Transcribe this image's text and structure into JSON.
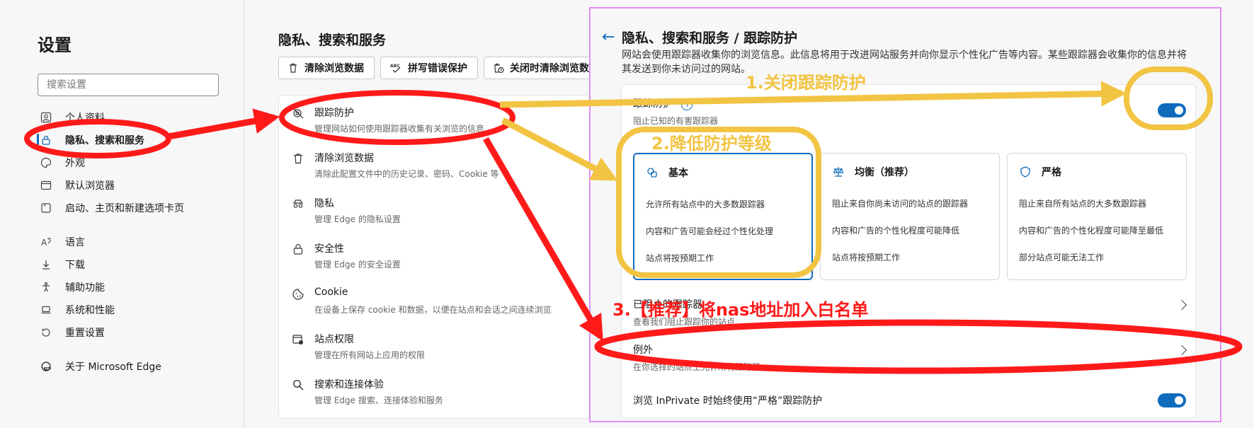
{
  "sidebar": {
    "title": "设置",
    "search_placeholder": "搜索设置",
    "items": [
      {
        "label": "个人资料"
      },
      {
        "label": "隐私、搜索和服务"
      },
      {
        "label": "外观"
      },
      {
        "label": "默认浏览器"
      },
      {
        "label": "启动、主页和新建选项卡页"
      },
      {
        "label": "语言"
      },
      {
        "label": "下载"
      },
      {
        "label": "辅助功能"
      },
      {
        "label": "系统和性能"
      },
      {
        "label": "重置设置"
      },
      {
        "label": "关于 Microsoft Edge"
      }
    ]
  },
  "middle": {
    "title": "隐私、搜索和服务",
    "chips": [
      "清除浏览数据",
      "拼写错误保护",
      "关闭时清除浏览数据"
    ],
    "rows": [
      {
        "title": "跟踪防护",
        "sub": "管理网站如何使用跟踪器收集有关浏览的信息"
      },
      {
        "title": "清除浏览数据",
        "sub": "清除此配置文件中的历史记录、密码、Cookie 等"
      },
      {
        "title": "隐私",
        "sub": "管理 Edge 的隐私设置"
      },
      {
        "title": "安全性",
        "sub": "管理 Edge 的安全设置"
      },
      {
        "title": "Cookie",
        "sub": "在设备上保存 cookie 和数据，以便在站点和会话之间连续浏览"
      },
      {
        "title": "站点权限",
        "sub": "管理在所有网站上应用的权限"
      },
      {
        "title": "搜索和连接体验",
        "sub": "管理 Edge 搜索、连接体验和服务"
      }
    ]
  },
  "panel": {
    "title": "隐私、搜索和服务 / 跟踪防护",
    "desc": "网站会使用跟踪器收集你的浏览信息。此信息将用于改进网站服务并向你显示个性化广告等内容。某些跟踪器会收集你的信息并将其发送到你未访问过的网站。",
    "tp_label": "跟踪防护",
    "tp_sub": "阻止已知的有害跟踪器",
    "levels": [
      {
        "name": "基本",
        "items": [
          "允许所有站点中的大多数跟踪器",
          "内容和广告可能会经过个性化处理",
          "站点将按预期工作"
        ]
      },
      {
        "name": "均衡（推荐）",
        "items": [
          "阻止来自你尚未访问的站点的跟踪器",
          "内容和广告的个性化程度可能降低",
          "站点将按预期工作"
        ]
      },
      {
        "name": "严格",
        "items": [
          "阻止来自所有站点的大多数跟踪器",
          "内容和广告的个性化程度可能降至最低",
          "部分站点可能无法工作"
        ]
      }
    ],
    "blocked_title": "已阻止的跟踪器",
    "blocked_sub": "查看我们阻止跟踪你的站点",
    "exceptions_title": "例外",
    "exceptions_sub": "在你选择的站点上允许所有跟踪器",
    "inprivate_label": "浏览 InPrivate 时始终使用“严格”跟踪防护"
  },
  "annotations": {
    "step1": "1.关闭跟踪防护",
    "step2": "2.降低防护等级",
    "step3": "3.【推荐】将nas地址加入白名单"
  },
  "colors": {
    "accent": "#0f6cbd",
    "red": "#ff1a1a",
    "yellow": "#f2c443",
    "panel_border": "#e38df3"
  }
}
